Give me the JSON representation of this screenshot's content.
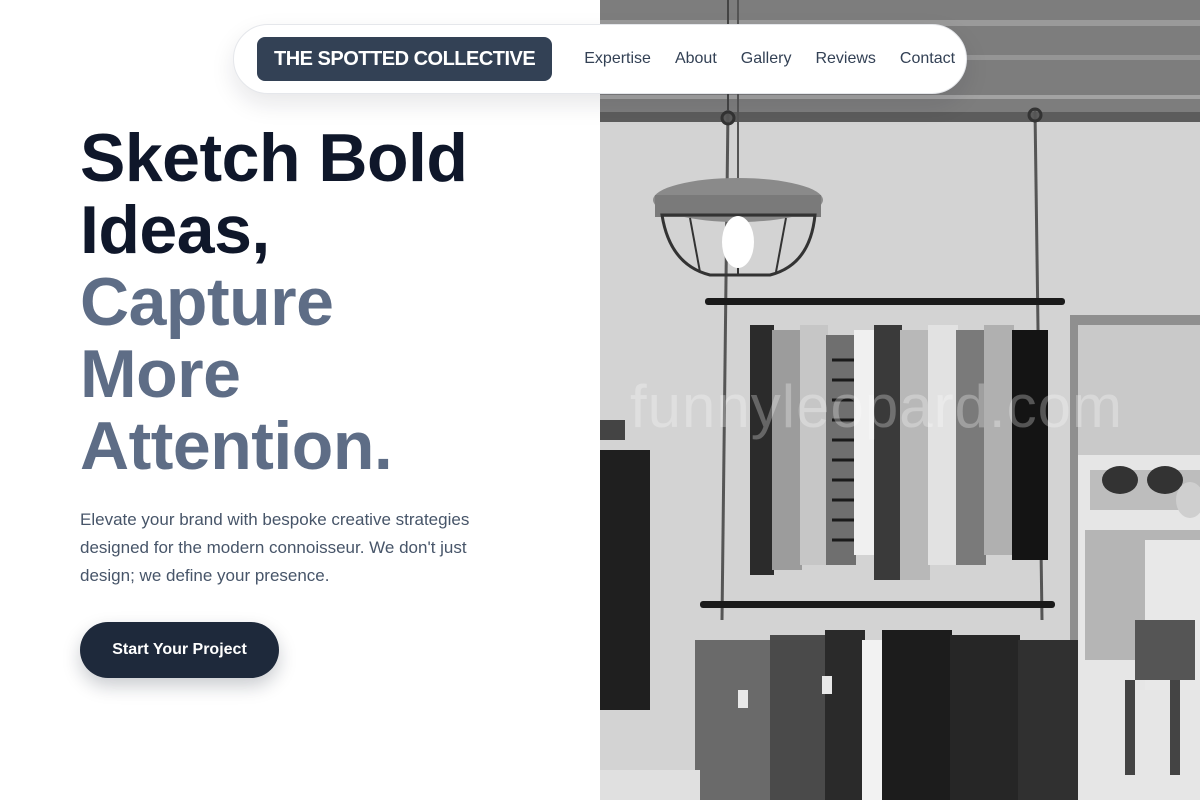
{
  "nav": {
    "brand": "THE SPOTTED COLLECTIVE",
    "links": [
      "Expertise",
      "About",
      "Gallery",
      "Reviews",
      "Contact"
    ]
  },
  "hero": {
    "headline_dark_1": "Sketch Bold",
    "headline_dark_2": "Ideas,",
    "headline_muted_1": "Capture",
    "headline_muted_2": "More",
    "headline_muted_3": "Attention.",
    "subtext": "Elevate your brand with bespoke creative strategies designed for the modern connoisseur. We don't just design; we define your presence.",
    "cta_label": "Start Your Project"
  },
  "image": {
    "watermark": "funnyleopard.com",
    "subject": "clothing-rack-photo"
  },
  "colors": {
    "brand_bg": "#334155",
    "headline_dark": "#0f172a",
    "headline_muted": "#5e6d86",
    "cta_bg": "#1e293b"
  }
}
